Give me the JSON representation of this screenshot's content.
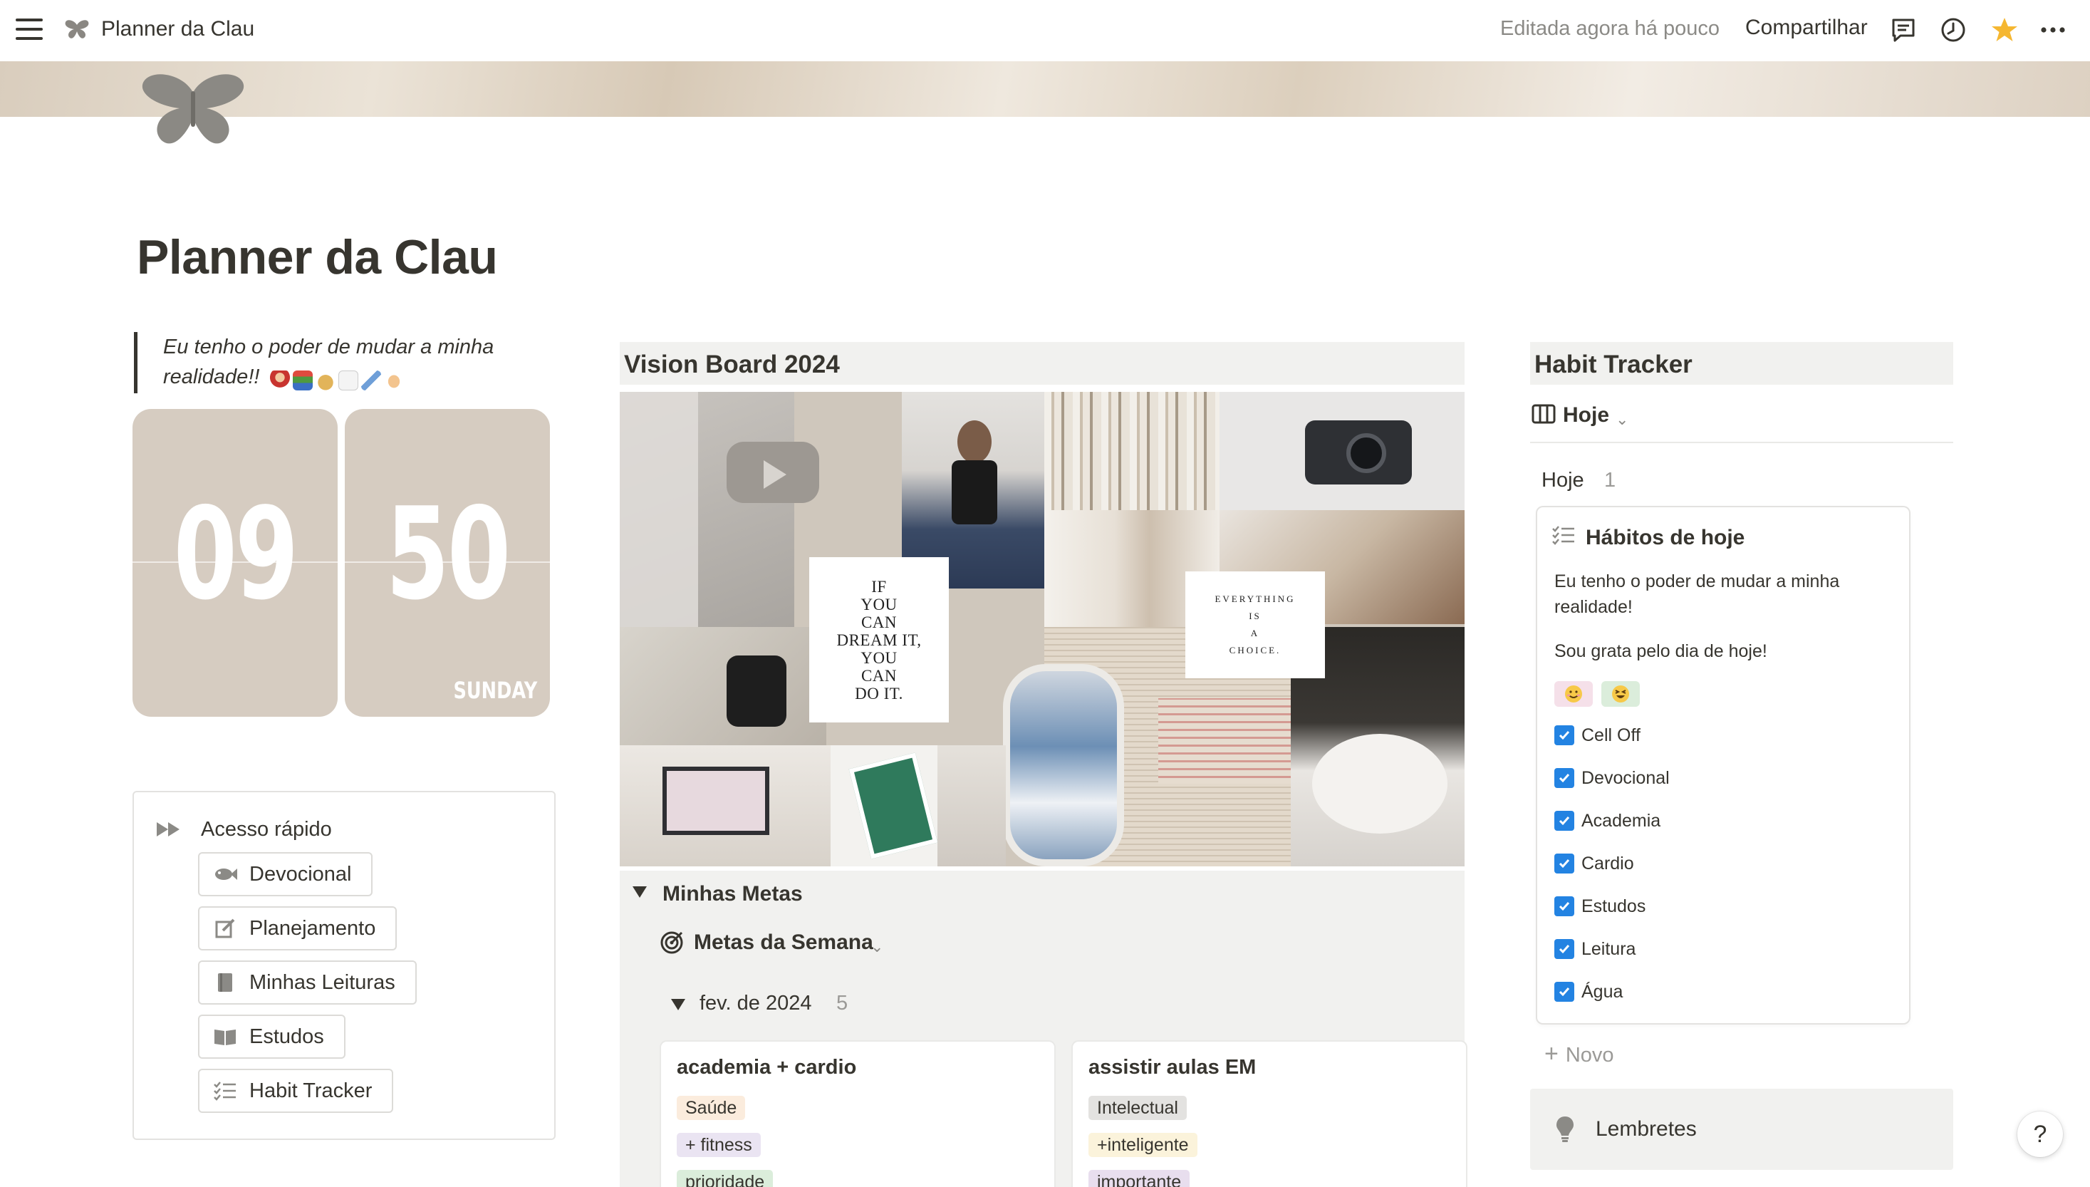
{
  "topbar": {
    "breadcrumb_title": "Planner da Clau",
    "edited_status": "Editada agora há pouco",
    "share_label": "Compartilhar",
    "icons": [
      "menu-icon",
      "butterfly-icon",
      "comment-icon",
      "history-icon",
      "star-icon",
      "more-icon"
    ],
    "favorite_color": "#f5b731"
  },
  "page": {
    "title": "Planner da Clau",
    "icon": "butterfly-icon"
  },
  "quote": {
    "text": "Eu tenho o poder de mudar a minha realidade!!",
    "emojis": [
      "weightlifter",
      "books",
      "money-bag",
      "chart-up",
      "airplane",
      "praying-hands"
    ]
  },
  "clock": {
    "hours": "09",
    "minutes": "50",
    "day": "SUNDAY",
    "card_color": "#d6ccc1"
  },
  "quick_access": {
    "title": "Acesso rápido",
    "icon": "fast-forward-icon",
    "items": [
      {
        "label": "Devocional",
        "icon": "fish-icon"
      },
      {
        "label": "Planejamento",
        "icon": "edit-icon"
      },
      {
        "label": "Minhas Leituras",
        "icon": "book-icon"
      },
      {
        "label": "Estudos",
        "icon": "open-book-icon"
      },
      {
        "label": "Habit Tracker",
        "icon": "checklist-icon"
      }
    ]
  },
  "vision_board": {
    "title": "Vision Board 2024",
    "quote_card_1": [
      "IF",
      "YOU",
      "CAN",
      "DREAM IT,",
      "YOU",
      "CAN",
      "DO IT."
    ],
    "quote_card_2": [
      "EVERYTHING",
      "IS",
      "A",
      "CHOICE."
    ]
  },
  "goals": {
    "toggle_title": "Minhas Metas",
    "view_name": "Metas da Semana",
    "view_icon": "target-icon",
    "group": {
      "label": "fev. de 2024",
      "count": "5"
    },
    "cards": [
      {
        "title": "academia + cardio",
        "tags": [
          "Saúde",
          "+ fitness",
          "prioridade"
        ]
      },
      {
        "title": "assistir aulas EM",
        "tags": [
          "Intelectual",
          "+inteligente",
          "importante"
        ]
      }
    ]
  },
  "habit_tracker": {
    "title": "Habit Tracker",
    "view_name": "Hoje",
    "view_icon": "board-icon",
    "group": {
      "label": "Hoje",
      "count": "1"
    },
    "card": {
      "title": "Hábitos de hoje",
      "affirmation": "Eu tenho o poder de mudar a minha realidade!",
      "gratitude": "Sou grata pelo dia de hoje!",
      "mood_emojis": [
        "smiling-face",
        "grinning-squinting-face"
      ],
      "habits": [
        {
          "label": "Cell Off",
          "checked": true
        },
        {
          "label": "Devocional",
          "checked": true
        },
        {
          "label": "Academia",
          "checked": true
        },
        {
          "label": "Cardio",
          "checked": true
        },
        {
          "label": "Estudos",
          "checked": true
        },
        {
          "label": "Leitura",
          "checked": true
        },
        {
          "label": "Água",
          "checked": true
        }
      ]
    },
    "new_label": "Novo",
    "checkbox_color": "#2383e2"
  },
  "reminders": {
    "label": "Lembretes",
    "icon": "lightbulb-icon"
  },
  "help": {
    "label": "?"
  }
}
